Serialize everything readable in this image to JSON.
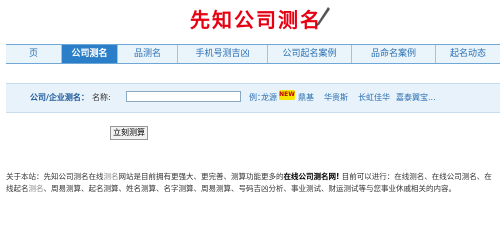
{
  "header": {
    "logo_text": "先知公司测名"
  },
  "nav": {
    "tabs": [
      {
        "label": "页",
        "active": false
      },
      {
        "label": "公司测名",
        "active": true
      },
      {
        "label": "品测名",
        "active": false
      },
      {
        "label": "手机号测吉凶",
        "active": false
      },
      {
        "label": "公司起名案例",
        "active": false
      },
      {
        "label": "品命名案例",
        "active": false
      },
      {
        "label": "起名动态",
        "active": false
      }
    ]
  },
  "search": {
    "category_label": "公司/企业测名：",
    "name_label": "名称:",
    "name_value": "",
    "examples_label": "例：",
    "examples": [
      "龙源",
      "鼎基",
      "华贵斯",
      "长虹佳华",
      "嘉泰翼宝..."
    ],
    "new_badge": "NEW",
    "submit_label": "立刻测算"
  },
  "about": {
    "prefix": "关于本站：先知公司测名在线",
    "gray_text": "测名",
    "middle": "网站是目前拥有更强大、更完善、测算功能更多的",
    "bold_text": "在线公司测名网!",
    "rest": " 目前可以进行：在线测名、在线公司测名、在线起名",
    "gray_text2": "测名",
    "rest2": "、周易测算、起名测算、姓名测算、名字测算、周易测算、号码吉凶分析、事业测试、财运测试等与您事业休戚相关的内容。"
  },
  "colors": {
    "brand": "#e60012",
    "nav_active": "#2b7fc9",
    "link": "#2a6fb3"
  }
}
